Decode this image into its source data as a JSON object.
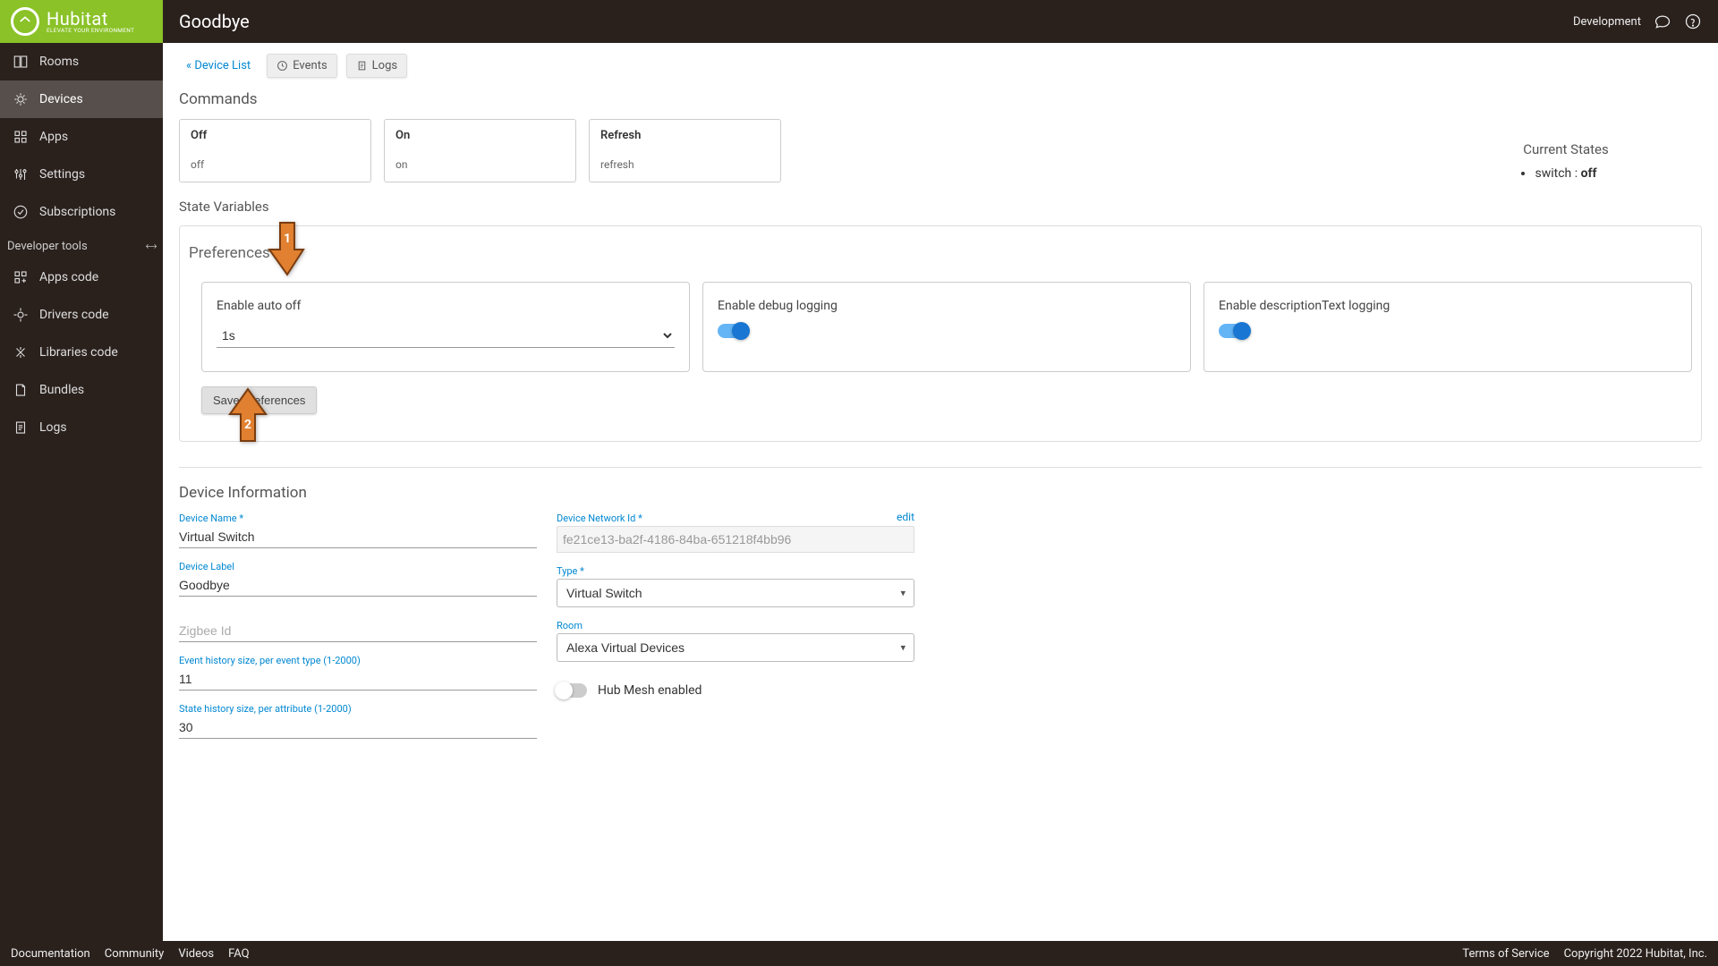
{
  "header": {
    "brand": "Hubitat",
    "tagline": "ELEVATE YOUR ENVIRONMENT",
    "page_title": "Goodbye",
    "dev_label": "Development"
  },
  "sidebar": {
    "items": [
      {
        "label": "Rooms"
      },
      {
        "label": "Devices"
      },
      {
        "label": "Apps"
      },
      {
        "label": "Settings"
      },
      {
        "label": "Subscriptions"
      }
    ],
    "section_title": "Developer tools",
    "dev_items": [
      {
        "label": "Apps code"
      },
      {
        "label": "Drivers code"
      },
      {
        "label": "Libraries code"
      },
      {
        "label": "Bundles"
      },
      {
        "label": "Logs"
      }
    ]
  },
  "tabs": {
    "device_list": "« Device List",
    "events": "Events",
    "logs": "Logs"
  },
  "commands": {
    "title": "Commands",
    "cards": [
      {
        "title": "Off",
        "sub": "off"
      },
      {
        "title": "On",
        "sub": "on"
      },
      {
        "title": "Refresh",
        "sub": "refresh"
      }
    ]
  },
  "current_states": {
    "title": "Current States",
    "items": [
      {
        "key": "switch",
        "value": "off"
      }
    ]
  },
  "state_variables_title": "State Variables",
  "preferences": {
    "title": "Preferences",
    "auto_off": {
      "label": "Enable auto off",
      "value": "1s"
    },
    "debug": {
      "label": "Enable debug logging",
      "on": true
    },
    "desc": {
      "label": "Enable descriptionText logging",
      "on": true
    },
    "save_label": "Save Preferences"
  },
  "annotations": {
    "arrow1": "1",
    "arrow2": "2"
  },
  "device_info": {
    "title": "Device Information",
    "name": {
      "label": "Device Name *",
      "value": "Virtual Switch"
    },
    "label": {
      "label": "Device Label",
      "value": "Goodbye"
    },
    "zigbee": {
      "placeholder": "Zigbee Id"
    },
    "event_hist": {
      "label": "Event history size, per event type (1-2000)",
      "value": "11"
    },
    "state_hist": {
      "label": "State history size, per attribute (1-2000)",
      "value": "30"
    },
    "network_id": {
      "label": "Device Network Id *",
      "value": "fe21ce13-ba2f-4186-84ba-651218f4bb96",
      "edit": "edit"
    },
    "type": {
      "label": "Type *",
      "value": "Virtual Switch"
    },
    "room": {
      "label": "Room",
      "value": "Alexa Virtual Devices"
    },
    "mesh": {
      "label": "Hub Mesh enabled",
      "on": false
    }
  },
  "footer": {
    "left": [
      "Documentation",
      "Community",
      "Videos",
      "FAQ"
    ],
    "right": [
      "Terms of Service",
      "Copyright 2022 Hubitat, Inc."
    ]
  }
}
